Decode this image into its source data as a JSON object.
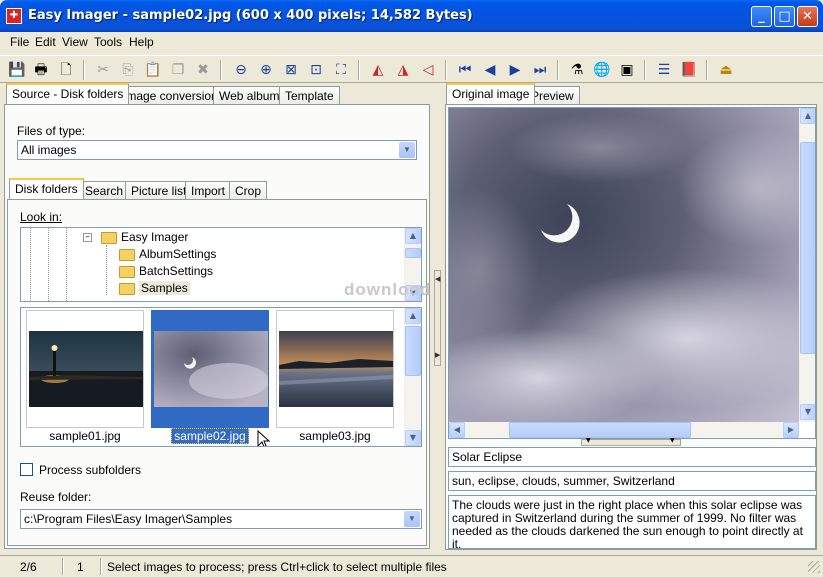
{
  "window": {
    "title": "Easy Imager - sample02.jpg  (600 x 400 pixels;  14,582 Bytes)",
    "app_icon_glyph": "✚",
    "minimize": "_",
    "maximize": "□",
    "close": "✕"
  },
  "menu": [
    "File",
    "Edit",
    "View",
    "Tools",
    "Help"
  ],
  "toolbar": {
    "icons": [
      "save-icon",
      "print-icon",
      "print-preview-icon",
      "cut-icon",
      "copy-icon",
      "paste-icon",
      "duplicate-icon",
      "delete-icon",
      "zoom-out-icon",
      "zoom-in-icon",
      "fit-window-icon",
      "actual-size-icon",
      "fit-screen-icon",
      "rotate-left-icon",
      "rotate-right-icon",
      "flip-icon",
      "first-image-icon",
      "previous-image-icon",
      "next-image-icon",
      "last-image-icon",
      "filter-icon",
      "web-icon",
      "slideshow-icon",
      "list-icon",
      "book-icon",
      "exit-icon"
    ],
    "glyphs": [
      "💾",
      "🖶",
      "🗋",
      "✂",
      "⎘",
      "📋",
      "❐",
      "✖",
      "⊖",
      "⊕",
      "⊠",
      "⊡",
      "⛶",
      "◭",
      "◮",
      "◁",
      "⏮",
      "◀",
      "▶",
      "⏭",
      "⚗",
      "🌐",
      "▣",
      "☰",
      "📕",
      "⏏"
    ]
  },
  "left_panel": {
    "tabs": [
      "Source - Disk folders",
      "Image conversion",
      "Web album",
      "Template"
    ],
    "files_of_type_label": "Files of type:",
    "files_of_type_value": "All images",
    "inner_tabs": [
      "Disk folders",
      "Search",
      "Picture list",
      "Import",
      "Crop"
    ],
    "look_in_label": "Look in:",
    "tree": [
      {
        "label": "Easy Imager",
        "expanded": true
      },
      {
        "label": "AlbumSettings"
      },
      {
        "label": "BatchSettings"
      },
      {
        "label": "Samples",
        "selected": true
      }
    ],
    "thumbnails": [
      {
        "label": "sample01.jpg",
        "selected": false
      },
      {
        "label": "sample02.jpg",
        "selected": true
      },
      {
        "label": "sample03.jpg",
        "selected": false
      }
    ],
    "process_subfolders_label": "Process subfolders",
    "process_subfolders_checked": false,
    "reuse_folder_label": "Reuse folder:",
    "reuse_folder_value": "c:\\Program Files\\Easy Imager\\Samples"
  },
  "right_panel": {
    "tabs": [
      "Original image",
      "Preview"
    ],
    "caption": "Solar Eclipse",
    "keywords": "sun, eclipse, clouds, summer, Switzerland",
    "description": "The clouds were just in the right place when this solar eclipse was captured in Switzerland during the summer of 1999. No filter was needed as the clouds darkened the sun enough to point directly at it."
  },
  "watermark": "download",
  "status": {
    "position": "2/6",
    "selected_count": "1",
    "message": "Select images to process; press Ctrl+click to select multiple files"
  },
  "colors": {
    "titlebar": "#0454e1",
    "selection": "#316ac5",
    "tab_highlight": "#ffc83c"
  }
}
